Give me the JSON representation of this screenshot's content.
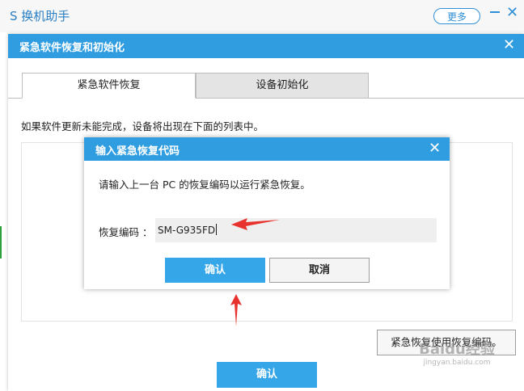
{
  "app": {
    "title": "S 换机助手",
    "more_label": "更多",
    "close_glyph": "✕"
  },
  "outer_dialog": {
    "title": "紧急软件恢复和初始化",
    "close_glyph": "✕",
    "tabs": [
      {
        "label": "紧急软件恢复",
        "active": true
      },
      {
        "label": "设备初始化",
        "active": false
      }
    ],
    "info_text": "如果软件更新未能完成，设备将出现在下面的列表中。",
    "code_button_label": "紧急恢复使用恢复编码。",
    "ok_label": "确认"
  },
  "modal": {
    "title": "输入紧急恢复代码",
    "close_glyph": "✕",
    "message": "请输入上一台 PC 的恢复编码以运行紧急恢复。",
    "code_label": "恢复编码 ：",
    "code_value": "SM-G935FD",
    "ok_label": "确认",
    "cancel_label": "取消"
  },
  "watermark": {
    "main": "Baidu经验",
    "sub": "jingyan.baidu.com"
  },
  "colors": {
    "accent": "#2f9de0",
    "button_blue": "#35a6e8",
    "arrow_red": "#e8322d"
  }
}
